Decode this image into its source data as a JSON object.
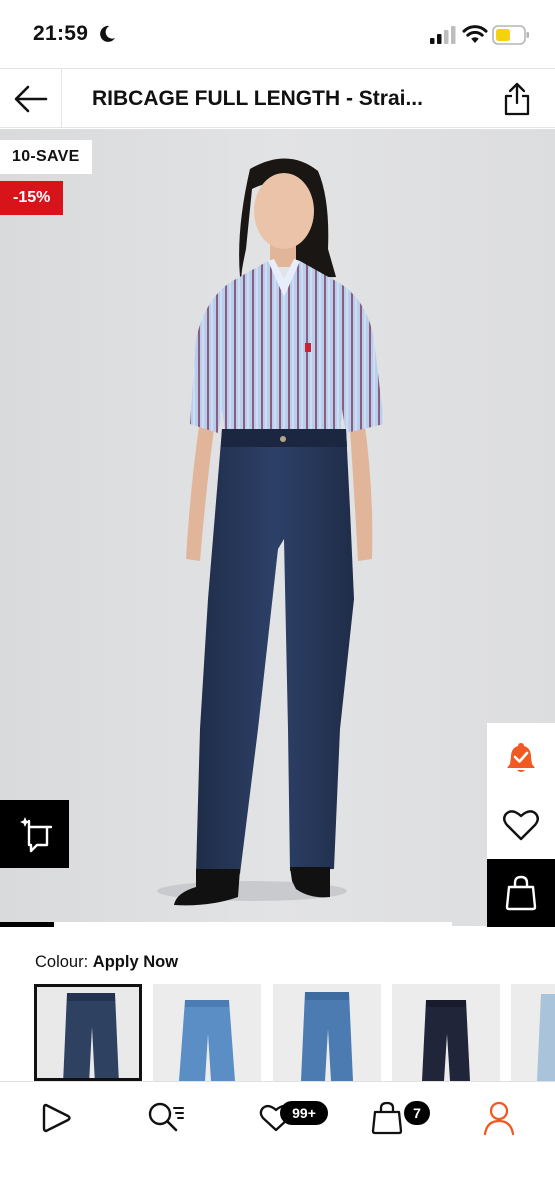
{
  "status_bar": {
    "time": "21:59",
    "icons": [
      "moon-icon",
      "cellular-signal-icon",
      "wifi-icon",
      "battery-icon"
    ],
    "battery_color": "#f5d20f"
  },
  "header": {
    "title": "RIBCAGE FULL LENGTH - Strai...",
    "back_icon": "arrow-left-icon",
    "share_icon": "share-icon"
  },
  "product": {
    "promo_code_badge": "10-SAVE",
    "discount_badge": "-15%",
    "discount_color": "#d7141a",
    "actions": [
      "bell-check-icon",
      "heart-icon",
      "shopping-bag-icon",
      "ar-view-icon"
    ],
    "alert_color": "#f05a22",
    "gallery_progress": 0.12
  },
  "colour": {
    "label": "Colour:",
    "value": "Apply Now",
    "swatches": [
      {
        "name": "dark-indigo",
        "color": "#2f4161",
        "selected": true
      },
      {
        "name": "mid-blue",
        "color": "#5b8ec4",
        "selected": false
      },
      {
        "name": "medium-blue",
        "color": "#4b7bb0",
        "selected": false
      },
      {
        "name": "black-navy",
        "color": "#20253a",
        "selected": false
      },
      {
        "name": "light-blue",
        "color": "#a9c4da",
        "selected": false
      }
    ]
  },
  "bottom_nav": {
    "items": [
      {
        "name": "home",
        "icon": "play-logo-icon"
      },
      {
        "name": "search",
        "icon": "search-list-icon"
      },
      {
        "name": "wishlist",
        "icon": "heart-icon",
        "badge": "99+"
      },
      {
        "name": "bag",
        "icon": "shopping-bag-icon",
        "badge": "7"
      },
      {
        "name": "account",
        "icon": "user-icon",
        "color": "#f05a22"
      }
    ]
  }
}
